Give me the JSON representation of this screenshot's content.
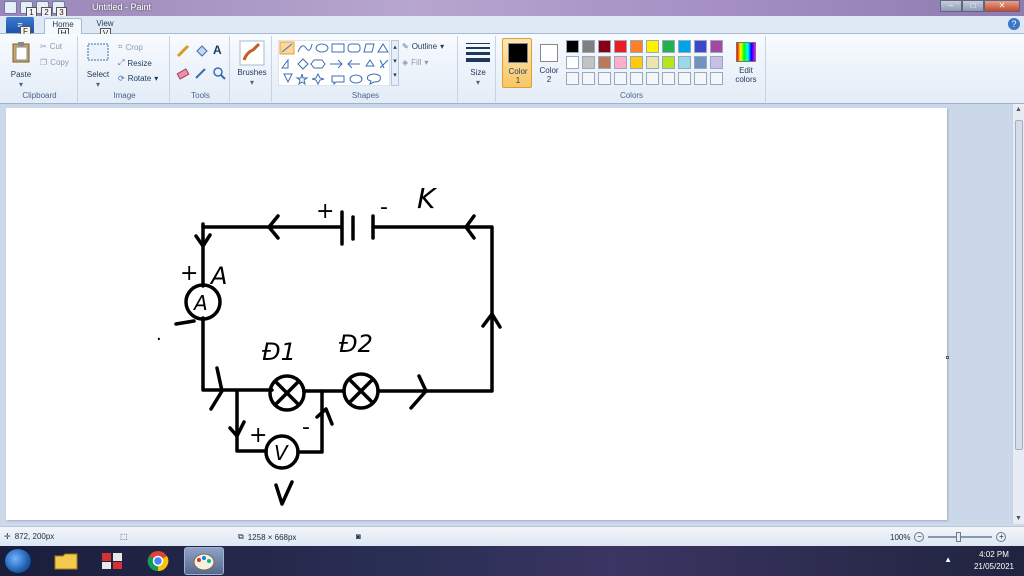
{
  "window": {
    "title": "Untitled - Paint",
    "min_label": "–",
    "max_label": "□",
    "close_label": "✕"
  },
  "keytips": {
    "qat1": "1",
    "qat2": "2",
    "qat3": "3",
    "file": "F",
    "home": "H",
    "view": "V"
  },
  "tabs": {
    "home": "Home",
    "view": "View"
  },
  "ribbon": {
    "clipboard": {
      "label": "Clipboard",
      "paste": "Paste",
      "cut": "Cut",
      "copy": "Copy"
    },
    "image": {
      "label": "Image",
      "select": "Select",
      "crop": "Crop",
      "resize": "Resize",
      "rotate": "Rotate"
    },
    "tools": {
      "label": "Tools"
    },
    "brushes": {
      "label": "Brushes"
    },
    "shapes": {
      "label": "Shapes",
      "outline": "Outline",
      "fill": "Fill"
    },
    "size": {
      "label": "Size"
    },
    "colors": {
      "label": "Colors",
      "color1": "Color\n1",
      "color2": "Color\n2",
      "edit": "Edit\ncolors",
      "palette_row1": [
        "#000000",
        "#7f7f7f",
        "#880015",
        "#ed1c24",
        "#ff7f27",
        "#fff200",
        "#22b14c",
        "#00a2e8",
        "#3f48cc",
        "#a349a4"
      ],
      "palette_row2": [
        "#ffffff",
        "#c3c3c3",
        "#b97a57",
        "#ffaec9",
        "#ffc90e",
        "#efe4b0",
        "#b5e61d",
        "#99d9ea",
        "#7092be",
        "#c8bfe7"
      ]
    }
  },
  "drawing": {
    "plus_battery": "+",
    "minus_battery": "-",
    "switch_label": "K",
    "plus_ammeter": "+",
    "ammeter_letter": "A",
    "ammeter_symbol": "A",
    "minus_ammeter": "-",
    "dot": ".",
    "lamp1_label": "Đ1",
    "lamp2_label": "Đ2",
    "plus_voltmeter": "+",
    "minus_voltmeter": "-",
    "voltmeter_symbol": "V",
    "voltmeter_label": "V"
  },
  "status": {
    "cursor_pos": "872, 200px",
    "image_size": "1258 × 668px",
    "zoom": "100%"
  },
  "clock": {
    "time": "4:02 PM",
    "date": "21/05/2021"
  }
}
